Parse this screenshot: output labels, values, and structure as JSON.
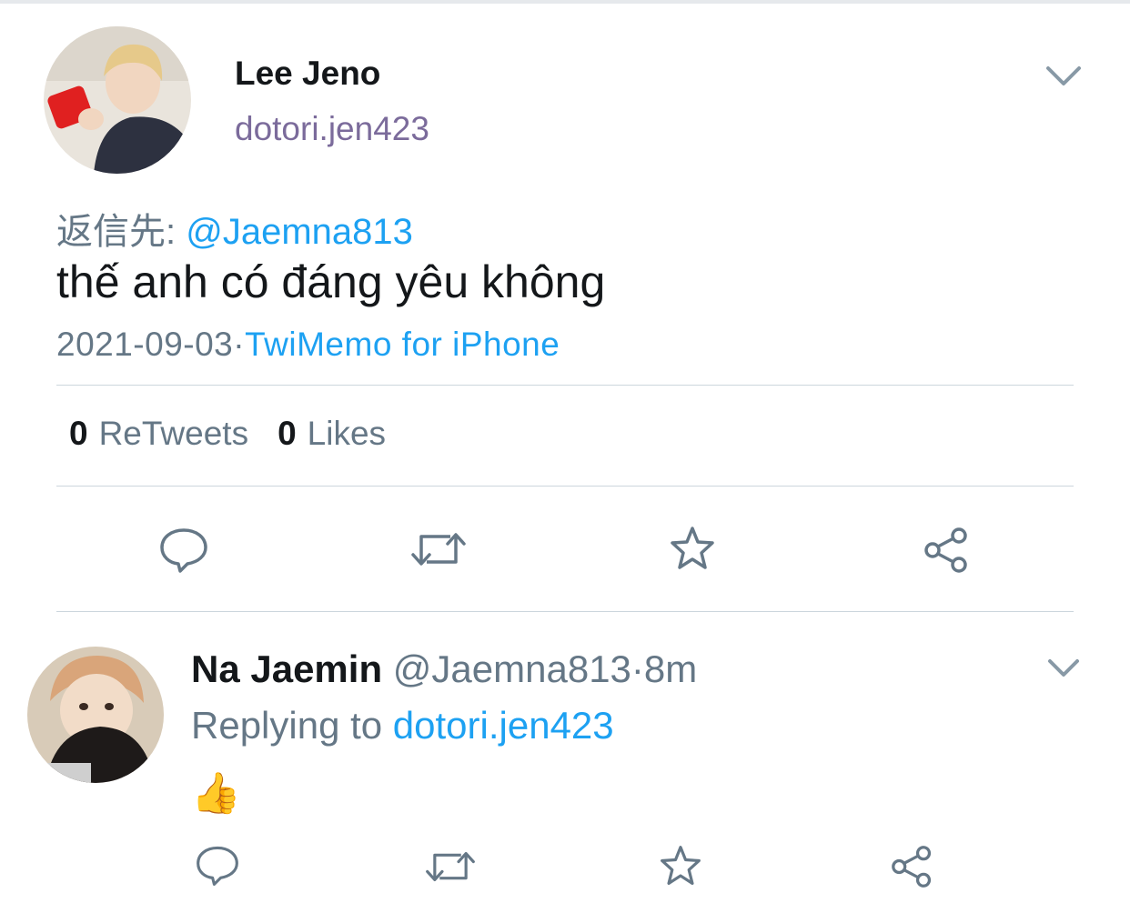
{
  "main_tweet": {
    "display_name": "Lee Jeno",
    "handle": "dotori.jen423",
    "reply_prefix": "返信先:",
    "reply_to": "@Jaemna813",
    "text": "thế anh có đáng yêu không",
    "date": "2021-09-03",
    "separator": "·",
    "source": "TwiMemo for iPhone",
    "retweet_count": "0",
    "retweet_label": "ReTweets",
    "like_count": "0",
    "like_label": "Likes"
  },
  "reply_tweet": {
    "display_name": "Na Jaemin",
    "handle": "@Jaemna813",
    "separator": "·",
    "time": "8m",
    "replying_label": "Replying to",
    "replying_to": "dotori.jen423",
    "text": "👍"
  },
  "icons": {
    "chevron": "chevron-down-icon",
    "reply": "reply-icon",
    "retweet": "retweet-icon",
    "like": "star-icon",
    "share": "share-icon"
  },
  "colors": {
    "link": "#1da1f2",
    "muted": "#657786",
    "handle": "#7b6b9b",
    "icon": "#657786",
    "divider": "#ccd6dd"
  }
}
